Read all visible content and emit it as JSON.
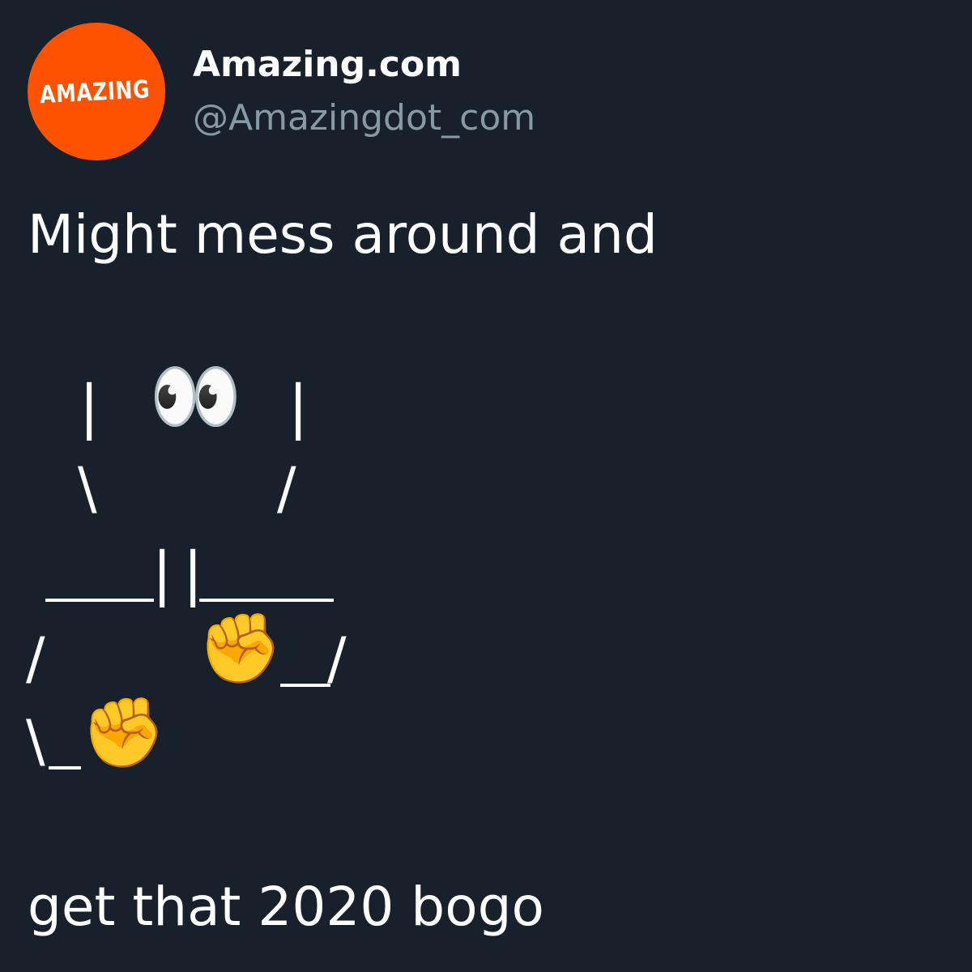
{
  "profile": {
    "avatar_text": "AMAZING",
    "display_name": "Amazing.com",
    "handle": "@Amazingdot_com"
  },
  "tweet": {
    "line_1": "Might mess around and",
    "line_last": "get that 2020 bogo"
  },
  "ascii_art": {
    "eyes": "👀",
    "fist": "✊",
    "pipe": "|",
    "backslash": "\\",
    "slash": "/"
  },
  "colors": {
    "background": "#17202b",
    "avatar": "#ff5200",
    "text": "#ffffff",
    "handle": "#8899a6"
  }
}
